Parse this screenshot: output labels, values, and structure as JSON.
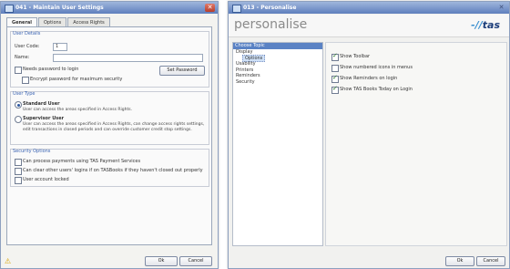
{
  "left_window": {
    "title": "041 - Maintain User Settings",
    "close": "✕",
    "tabs": [
      "General",
      "Options",
      "Access Rights"
    ],
    "user_details": {
      "group_title": "User Details",
      "user_code_label": "User Code:",
      "user_code_value": "1",
      "name_label": "Name:",
      "name_value": "",
      "needs_password_label": "Needs password to login",
      "encrypt_label": "Encrypt password for maximum security",
      "set_password_button": "Set Password"
    },
    "user_type": {
      "group_title": "User Type",
      "standard_label": "Standard User",
      "standard_desc": "User can access the areas specified in Access Rights.",
      "supervisor_label": "Supervisor User",
      "supervisor_desc": "User can access the areas specified in Access Rights, can change access rights settings, edit transactions in closed periods and can override customer credit stop settings."
    },
    "security": {
      "group_title": "Security Options",
      "options": [
        "Can process payments using TAS Payment Services",
        "Can clear other users' logins if on TASBooks if they haven't closed out properly",
        "User account locked"
      ]
    },
    "ok_button": "Ok",
    "cancel_button": "Cancel",
    "warning_icon": "⚠"
  },
  "right_window": {
    "title": "013 - Personalise",
    "close": "✕",
    "banner_title": "personalise",
    "logo_text": "tas",
    "logo_prefix": "-//",
    "topics_header": "Choose Topic",
    "topics": [
      "Display",
      "Options",
      "Usability",
      "Printers",
      "Reminders",
      "Security"
    ],
    "selected_topic": "Options",
    "options": [
      {
        "label": "Show Toolbar",
        "checked": true
      },
      {
        "label": "Show numbered icons in menus",
        "checked": false
      },
      {
        "label": "Show Reminders on login",
        "checked": true
      },
      {
        "label": "Show TAS Books Today on Login",
        "checked": true
      }
    ],
    "ok_button": "Ok",
    "cancel_button": "Cancel"
  },
  "colors": {
    "title_bar": "#5f7fbd",
    "group_title": "#3b64b3",
    "logo": "#1d3e7a"
  }
}
